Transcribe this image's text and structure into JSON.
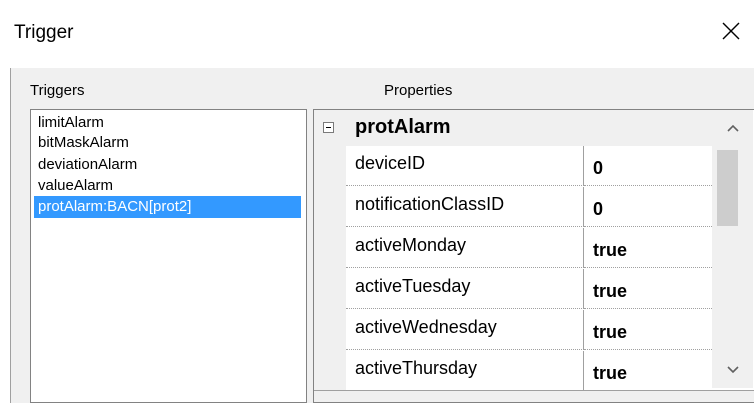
{
  "window": {
    "title": "Trigger"
  },
  "triggers": {
    "label": "Triggers",
    "items": [
      {
        "label": "limitAlarm",
        "selected": false
      },
      {
        "label": "bitMaskAlarm",
        "selected": false
      },
      {
        "label": "deviationAlarm",
        "selected": false
      },
      {
        "label": "valueAlarm",
        "selected": false
      },
      {
        "label": "protAlarm:BACN[prot2]",
        "selected": true
      }
    ]
  },
  "properties": {
    "label": "Properties",
    "category": "protAlarm",
    "rows": [
      {
        "name": "deviceID",
        "value": "0"
      },
      {
        "name": "notificationClassID",
        "value": "0"
      },
      {
        "name": "activeMonday",
        "value": "true"
      },
      {
        "name": "activeTuesday",
        "value": "true"
      },
      {
        "name": "activeWednesday",
        "value": "true"
      },
      {
        "name": "activeThursday",
        "value": "true"
      }
    ]
  },
  "colors": {
    "selection": "#3399ff",
    "panel": "#f0f0f0",
    "border": "#828282"
  },
  "icons": {
    "close": "close-icon",
    "collapse": "collapse-minus-icon",
    "scroll_up": "chevron-up-icon",
    "scroll_down": "chevron-down-icon"
  }
}
